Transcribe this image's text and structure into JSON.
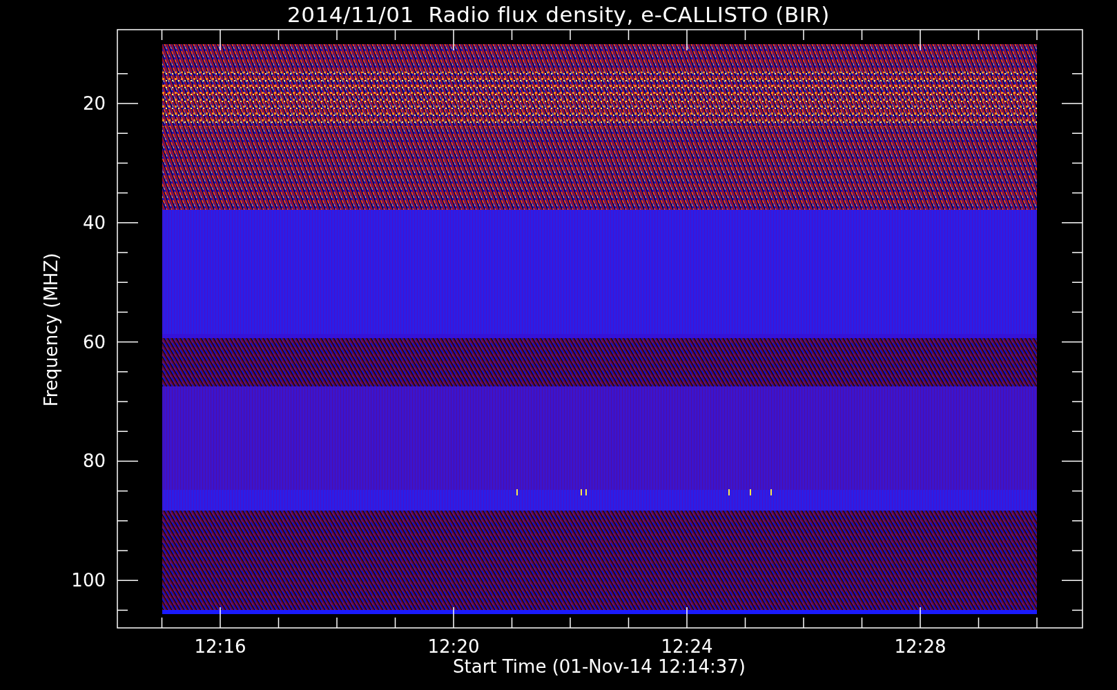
{
  "title": "2014/11/01  Radio flux density, e-CALLISTO (BIR)",
  "plot": {
    "ylabel": "Frequency (MHZ)",
    "xlabel": "Start Time (01-Nov-14 12:14:37)",
    "yticks": [
      "20",
      "40",
      "60",
      "80",
      "100"
    ],
    "xticks": [
      "12:16",
      "12:20",
      "12:24",
      "12:28"
    ]
  }
}
